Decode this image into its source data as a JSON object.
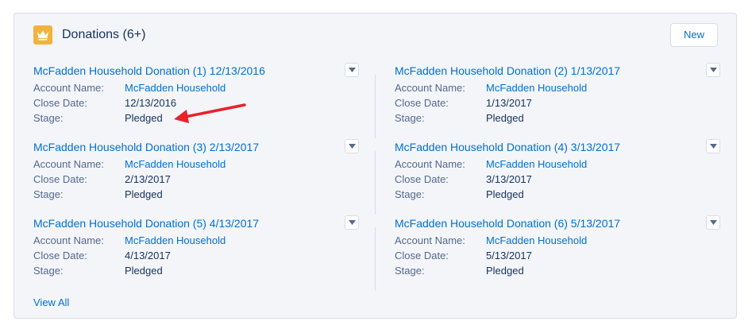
{
  "card": {
    "title": "Donations (6+)",
    "icon": "crown-icon",
    "icon_color": "#f3b23b",
    "new_label": "New",
    "view_all_label": "View All"
  },
  "labels": {
    "account": "Account Name:",
    "close_date": "Close Date:",
    "stage": "Stage:"
  },
  "records": [
    {
      "title": "McFadden Household Donation (1) 12/13/2016",
      "account": "McFadden Household",
      "close_date": "12/13/2016",
      "stage": "Pledged"
    },
    {
      "title": "McFadden Household Donation (2) 1/13/2017",
      "account": "McFadden Household",
      "close_date": "1/13/2017",
      "stage": "Pledged"
    },
    {
      "title": "McFadden Household Donation (3) 2/13/2017",
      "account": "McFadden Household",
      "close_date": "2/13/2017",
      "stage": "Pledged"
    },
    {
      "title": "McFadden Household Donation (4) 3/13/2017",
      "account": "McFadden Household",
      "close_date": "3/13/2017",
      "stage": "Pledged"
    },
    {
      "title": "McFadden Household Donation (5) 4/13/2017",
      "account": "McFadden Household",
      "close_date": "4/13/2017",
      "stage": "Pledged"
    },
    {
      "title": "McFadden Household Donation (6) 5/13/2017",
      "account": "McFadden Household",
      "close_date": "5/13/2017",
      "stage": "Pledged"
    }
  ],
  "colors": {
    "link": "#0070d2",
    "annotation_arrow": "#e8222b"
  }
}
